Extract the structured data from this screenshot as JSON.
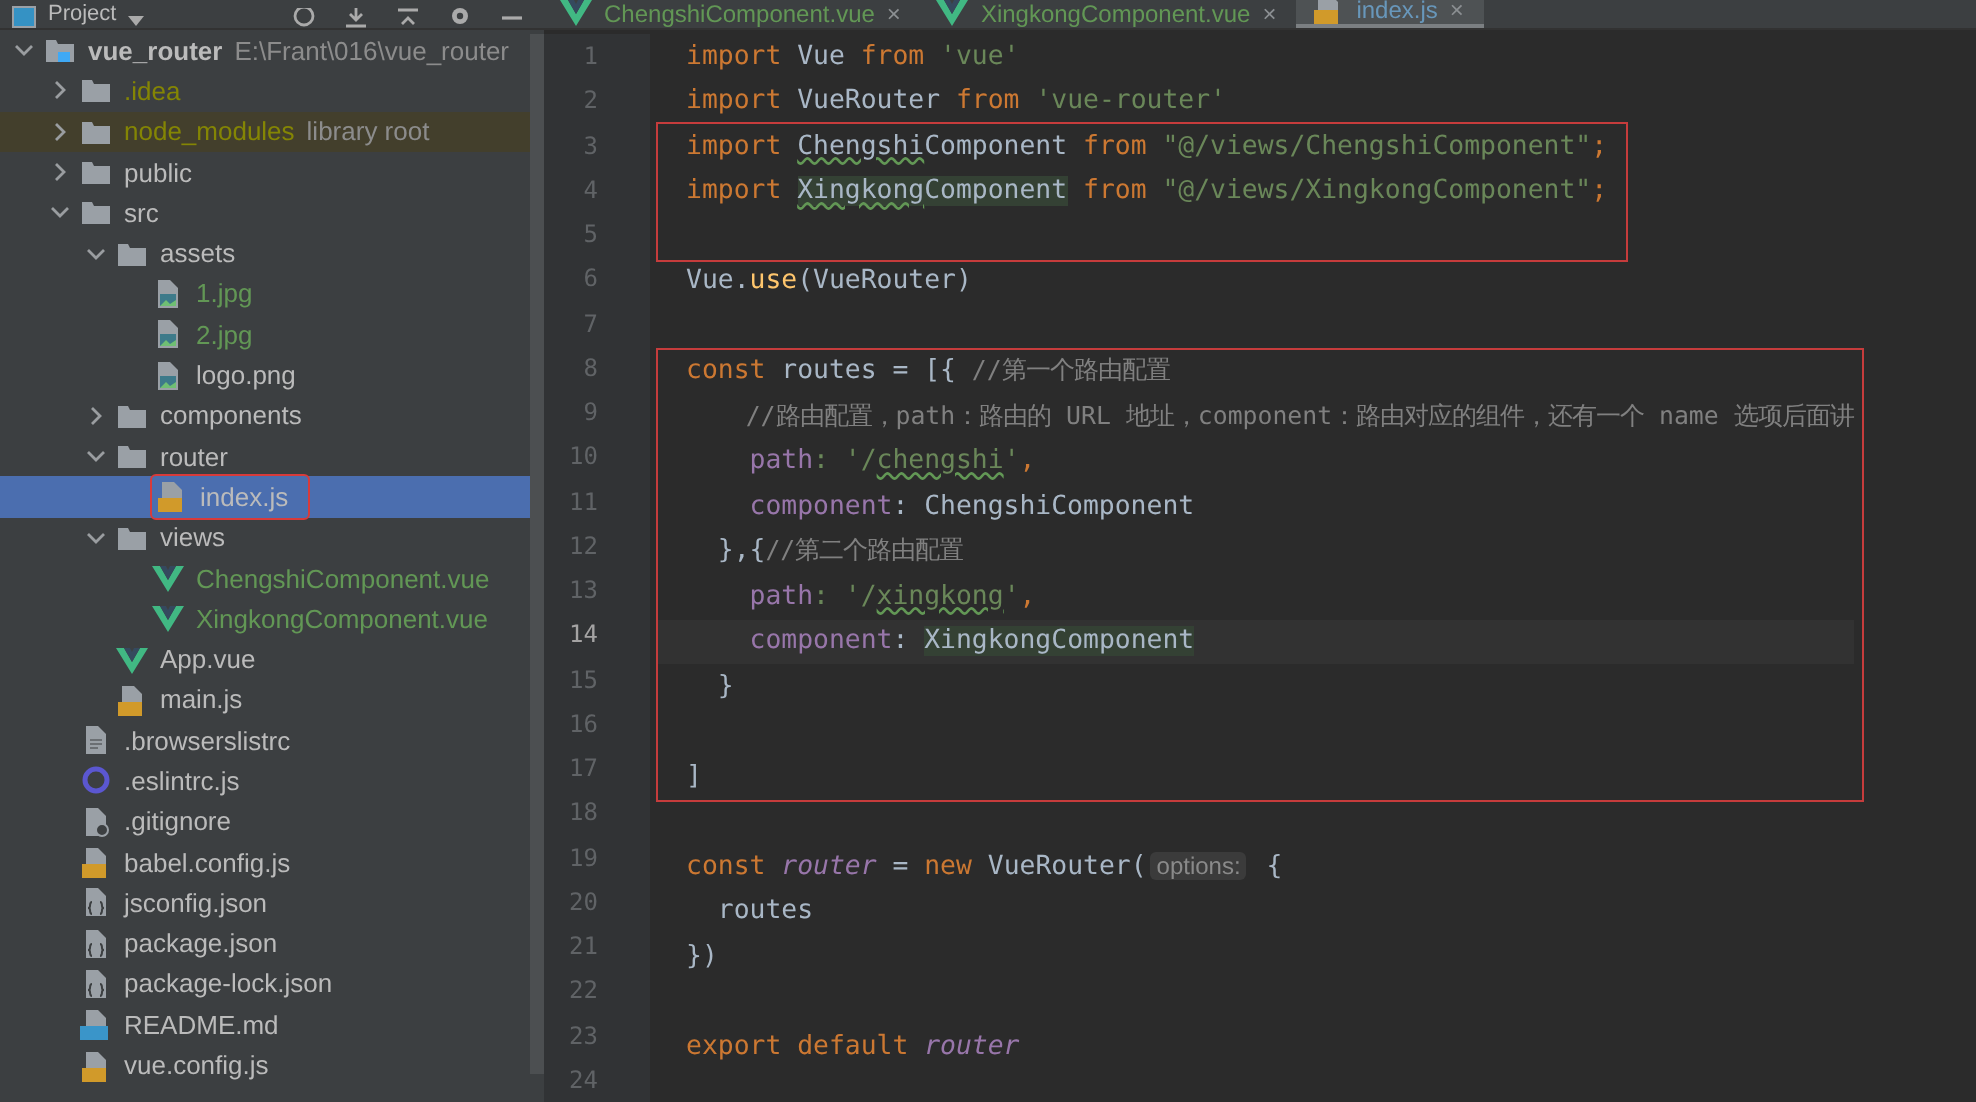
{
  "project_panel": {
    "title": "Project",
    "tree": [
      {
        "name": "vue_router",
        "note": "E:\\Frant\\016\\vue_router",
        "kind": "root",
        "color": "#bbbbbb",
        "expanded": true,
        "selected": false,
        "children": [
          {
            "name": ".idea",
            "kind": "folder",
            "color": "#848504",
            "expanded": false,
            "selected": false
          },
          {
            "name": "node_modules",
            "note": "library root",
            "kind": "library",
            "color": "#848504",
            "expanded": false,
            "selected": false
          },
          {
            "name": "public",
            "kind": "folder",
            "color": "#bbbbbb",
            "expanded": false,
            "selected": false
          },
          {
            "name": "src",
            "kind": "folder",
            "color": "#bbbbbb",
            "expanded": true,
            "selected": false,
            "children": [
              {
                "name": "assets",
                "kind": "folder",
                "color": "#bbbbbb",
                "expanded": true,
                "selected": false,
                "children": [
                  {
                    "name": "1.jpg",
                    "kind": "image",
                    "color": "#629755",
                    "selected": false
                  },
                  {
                    "name": "2.jpg",
                    "kind": "image",
                    "color": "#629755",
                    "selected": false
                  },
                  {
                    "name": "logo.png",
                    "kind": "image",
                    "color": "#bbbbbb",
                    "selected": false
                  }
                ]
              },
              {
                "name": "components",
                "kind": "folder",
                "color": "#bbbbbb",
                "expanded": false,
                "selected": false
              },
              {
                "name": "router",
                "kind": "folder",
                "color": "#bbbbbb",
                "expanded": true,
                "selected": false,
                "children": [
                  {
                    "name": "index.js",
                    "kind": "js",
                    "color": "#bbbbbb",
                    "selected": true,
                    "boxed": true
                  }
                ]
              },
              {
                "name": "views",
                "kind": "folder",
                "color": "#bbbbbb",
                "expanded": true,
                "selected": false,
                "children": [
                  {
                    "name": "ChengshiComponent.vue",
                    "kind": "vue",
                    "color": "#629755",
                    "selected": false
                  },
                  {
                    "name": "XingkongComponent.vue",
                    "kind": "vue",
                    "color": "#629755",
                    "selected": false
                  }
                ]
              },
              {
                "name": "App.vue",
                "kind": "vue",
                "color": "#bbbbbb",
                "selected": false
              },
              {
                "name": "main.js",
                "kind": "js",
                "color": "#bbbbbb",
                "selected": false
              }
            ]
          },
          {
            "name": ".browserslistrc",
            "kind": "text",
            "color": "#bbbbbb",
            "selected": false
          },
          {
            "name": ".eslintrc.js",
            "kind": "eslint",
            "color": "#bbbbbb",
            "selected": false
          },
          {
            "name": ".gitignore",
            "kind": "gitignore",
            "color": "#bbbbbb",
            "selected": false
          },
          {
            "name": "babel.config.js",
            "kind": "js",
            "color": "#bbbbbb",
            "selected": false
          },
          {
            "name": "jsconfig.json",
            "kind": "json",
            "color": "#bbbbbb",
            "selected": false
          },
          {
            "name": "package.json",
            "kind": "json",
            "color": "#bbbbbb",
            "selected": false
          },
          {
            "name": "package-lock.json",
            "kind": "json",
            "color": "#bbbbbb",
            "selected": false
          },
          {
            "name": "README.md",
            "kind": "md",
            "color": "#bbbbbb",
            "selected": false
          },
          {
            "name": "vue.config.js",
            "kind": "js",
            "color": "#bbbbbb",
            "selected": false
          }
        ]
      }
    ]
  },
  "tabs": [
    {
      "label": "ChengshiComponent.vue",
      "kind": "vue",
      "color": "#629755",
      "close": "×",
      "selected": false
    },
    {
      "label": "XingkongComponent.vue",
      "kind": "vue",
      "color": "#629755",
      "close": "×",
      "selected": false
    },
    {
      "label": "index.js",
      "kind": "js",
      "color": "#6897bb",
      "close": "×",
      "selected": true
    }
  ],
  "editor": {
    "blocks": [
      {
        "boxed": false,
        "lines": [
          {
            "number": "1",
            "current": false,
            "tokens": [
              {
                "text": "import",
                "kind": "kw"
              },
              {
                "text": " Vue ",
                "kind": "plain"
              },
              {
                "text": "from",
                "kind": "kw"
              },
              {
                "text": " 'vue'",
                "kind": "str"
              }
            ]
          },
          {
            "number": "2",
            "current": false,
            "tokens": [
              {
                "text": "import",
                "kind": "kw"
              },
              {
                "text": " VueRouter ",
                "kind": "plain"
              },
              {
                "text": "from",
                "kind": "kw"
              },
              {
                "text": " 'vue-router'",
                "kind": "str"
              }
            ]
          }
        ]
      },
      {
        "boxed": true,
        "lines": [
          {
            "number": "3",
            "current": false,
            "tokens": [
              {
                "text": "import ",
                "kind": "kw"
              },
              {
                "text": "Chengshi",
                "kind": "typo"
              },
              {
                "text": "Component ",
                "kind": "plain"
              },
              {
                "text": "from",
                "kind": "kw"
              },
              {
                "text": " \"@/views/ChengshiComponent\"",
                "kind": "str"
              },
              {
                "text": ";",
                "kind": "kw"
              }
            ]
          },
          {
            "number": "4",
            "current": false,
            "tokens": [
              {
                "text": "import ",
                "kind": "kw"
              },
              {
                "text": "Xingkong",
                "kind": "typo-hl"
              },
              {
                "text": "Component",
                "kind": "hl"
              },
              {
                "text": " from",
                "kind": "kw"
              },
              {
                "text": " \"@/views/XingkongComponent\"",
                "kind": "str"
              },
              {
                "text": ";",
                "kind": "kw"
              }
            ]
          },
          {
            "number": "5",
            "current": false
          }
        ]
      },
      {
        "boxed": false,
        "lines": [
          {
            "number": "6",
            "current": false,
            "tokens": [
              {
                "text": "Vue.",
                "kind": "plain"
              },
              {
                "text": "use",
                "kind": "fn"
              },
              {
                "text": "(VueRouter)",
                "kind": "plain"
              }
            ]
          },
          {
            "number": "7",
            "current": false
          }
        ]
      },
      {
        "boxed": true,
        "lines": [
          {
            "number": "8",
            "current": false,
            "tokens": [
              {
                "text": "const",
                "kind": "kw"
              },
              {
                "text": " routes = [{ ",
                "kind": "plain"
              },
              {
                "text": "//第一个路由配置",
                "kind": "comment"
              }
            ]
          },
          {
            "number": "9",
            "current": false,
            "tokens": [
              {
                "text": "    //路由配置，path：路由的 URL 地址，component：路由对应的组件，还有一个 name 选项后面讲",
                "kind": "comment"
              }
            ]
          },
          {
            "number": "10",
            "current": false,
            "tokens": [
              {
                "text": "    path",
                "kind": "prop"
              },
              {
                "text": ": '/",
                "kind": "str"
              },
              {
                "text": "chengshi",
                "kind": "str-typo"
              },
              {
                "text": "'",
                "kind": "str"
              },
              {
                "text": ",",
                "kind": "kw"
              }
            ]
          },
          {
            "number": "11",
            "current": false,
            "tokens": [
              {
                "text": "    component",
                "kind": "prop"
              },
              {
                "text": ": ChengshiComponent",
                "kind": "plain"
              }
            ]
          },
          {
            "number": "12",
            "current": false,
            "tokens": [
              {
                "text": "  },{",
                "kind": "plain"
              },
              {
                "text": "//第二个路由配置",
                "kind": "comment"
              }
            ]
          },
          {
            "number": "13",
            "current": false,
            "tokens": [
              {
                "text": "    path",
                "kind": "prop"
              },
              {
                "text": ": '/",
                "kind": "str"
              },
              {
                "text": "xingkong",
                "kind": "str-typo"
              },
              {
                "text": "'",
                "kind": "str"
              },
              {
                "text": ",",
                "kind": "kw"
              }
            ]
          },
          {
            "number": "14",
            "current": true,
            "tokens": [
              {
                "text": "    component",
                "kind": "prop"
              },
              {
                "text": ": ",
                "kind": "plain"
              },
              {
                "text": "XingkongComponent",
                "kind": "hl"
              }
            ]
          },
          {
            "number": "15",
            "current": false,
            "tokens": [
              {
                "text": "  }",
                "kind": "plain"
              }
            ]
          },
          {
            "number": "16",
            "current": false
          },
          {
            "number": "17",
            "current": false,
            "tokens": [
              {
                "text": "]",
                "kind": "plain"
              }
            ]
          }
        ]
      },
      {
        "boxed": false,
        "lines": [
          {
            "number": "18",
            "current": false
          },
          {
            "number": "19",
            "current": false,
            "tokens": [
              {
                "text": "const ",
                "kind": "kw"
              },
              {
                "text": "router",
                "kind": "ivar"
              },
              {
                "text": " = ",
                "kind": "plain"
              },
              {
                "text": "new",
                "kind": "kw"
              },
              {
                "text": " VueRouter(",
                "kind": "plain"
              },
              {
                "text": "options:",
                "kind": "hint"
              },
              {
                "text": " {",
                "kind": "plain"
              }
            ]
          },
          {
            "number": "20",
            "current": false,
            "tokens": [
              {
                "text": "  routes",
                "kind": "plain"
              }
            ]
          },
          {
            "number": "21",
            "current": false,
            "tokens": [
              {
                "text": "})",
                "kind": "plain"
              }
            ]
          },
          {
            "number": "22",
            "current": false
          },
          {
            "number": "23",
            "current": false,
            "tokens": [
              {
                "text": "export default ",
                "kind": "kw"
              },
              {
                "text": "router",
                "kind": "ivar"
              }
            ]
          },
          {
            "number": "24",
            "current": false
          }
        ]
      }
    ]
  }
}
